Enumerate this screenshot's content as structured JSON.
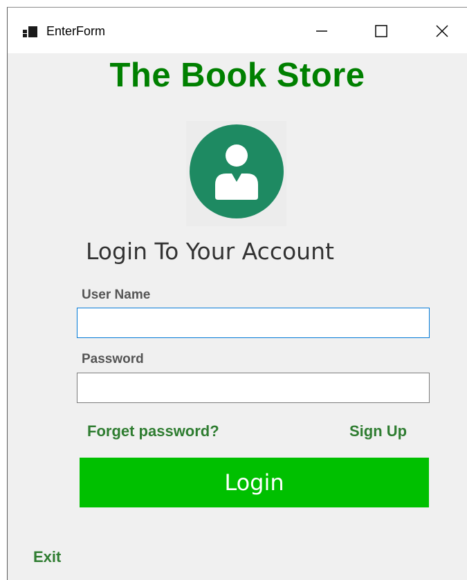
{
  "window": {
    "title": "EnterForm",
    "controls": {
      "minimize": "minimize",
      "maximize": "maximize",
      "close": "close"
    }
  },
  "header": {
    "store_title": "The Book Store"
  },
  "avatar": {
    "icon": "user-avatar-icon"
  },
  "form": {
    "heading": "Login To Your Account",
    "username_label": "User Name",
    "username_value": "",
    "password_label": "Password",
    "password_value": "",
    "forget_password_link": "Forget password?",
    "signup_link": "Sign Up",
    "login_button": "Login"
  },
  "footer": {
    "exit_link": "Exit"
  },
  "colors": {
    "title_green": "#008000",
    "link_green": "#2f7d31",
    "button_green": "#00c000",
    "avatar_green": "#1e8a62",
    "focus_border": "#0078d7"
  }
}
